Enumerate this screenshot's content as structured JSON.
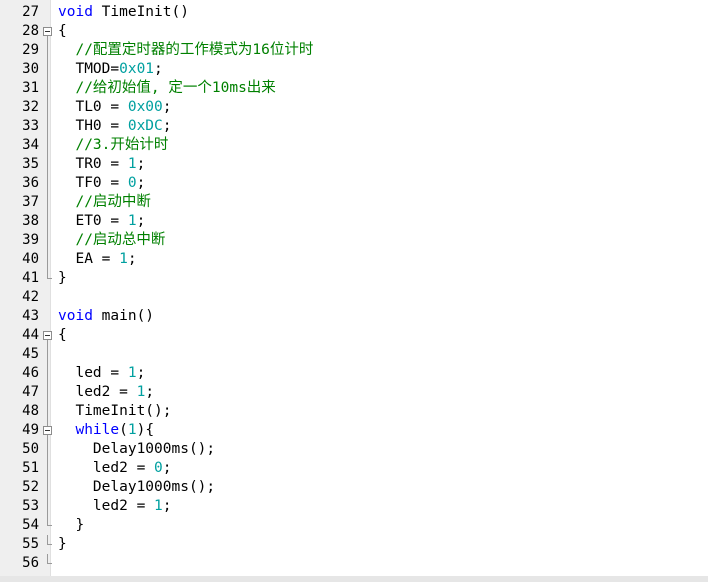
{
  "editor": {
    "lines": [
      {
        "n": "27",
        "fold": "none",
        "segs": [
          {
            "t": "void",
            "c": "kw"
          },
          {
            "t": " TimeInit()",
            "c": ""
          }
        ]
      },
      {
        "n": "28",
        "fold": "open",
        "segs": [
          {
            "t": "{",
            "c": ""
          }
        ]
      },
      {
        "n": "29",
        "fold": "line",
        "segs": [
          {
            "t": "  ",
            "c": ""
          },
          {
            "t": "//配置定时器的工作模式为16位计时",
            "c": "cm"
          }
        ]
      },
      {
        "n": "30",
        "fold": "line",
        "segs": [
          {
            "t": "  TMOD=",
            "c": ""
          },
          {
            "t": "0x01",
            "c": "num"
          },
          {
            "t": ";",
            "c": ""
          }
        ]
      },
      {
        "n": "31",
        "fold": "line",
        "segs": [
          {
            "t": "  ",
            "c": ""
          },
          {
            "t": "//给初始值, 定一个10ms出来",
            "c": "cm"
          }
        ]
      },
      {
        "n": "32",
        "fold": "line",
        "segs": [
          {
            "t": "  TL0 = ",
            "c": ""
          },
          {
            "t": "0x00",
            "c": "num"
          },
          {
            "t": ";",
            "c": ""
          }
        ]
      },
      {
        "n": "33",
        "fold": "line",
        "segs": [
          {
            "t": "  TH0 = ",
            "c": ""
          },
          {
            "t": "0xDC",
            "c": "num"
          },
          {
            "t": ";",
            "c": ""
          }
        ]
      },
      {
        "n": "34",
        "fold": "line",
        "segs": [
          {
            "t": "  ",
            "c": ""
          },
          {
            "t": "//3.开始计时",
            "c": "cm"
          }
        ]
      },
      {
        "n": "35",
        "fold": "line",
        "segs": [
          {
            "t": "  TR0 = ",
            "c": ""
          },
          {
            "t": "1",
            "c": "num"
          },
          {
            "t": ";",
            "c": ""
          }
        ]
      },
      {
        "n": "36",
        "fold": "line",
        "segs": [
          {
            "t": "  TF0 = ",
            "c": ""
          },
          {
            "t": "0",
            "c": "num"
          },
          {
            "t": ";",
            "c": ""
          }
        ]
      },
      {
        "n": "37",
        "fold": "line",
        "segs": [
          {
            "t": "  ",
            "c": ""
          },
          {
            "t": "//启动中断",
            "c": "cm"
          }
        ]
      },
      {
        "n": "38",
        "fold": "line",
        "segs": [
          {
            "t": "  ET0 = ",
            "c": ""
          },
          {
            "t": "1",
            "c": "num"
          },
          {
            "t": ";",
            "c": ""
          }
        ]
      },
      {
        "n": "39",
        "fold": "line",
        "segs": [
          {
            "t": "  ",
            "c": ""
          },
          {
            "t": "//启动总中断",
            "c": "cm"
          }
        ]
      },
      {
        "n": "40",
        "fold": "line",
        "segs": [
          {
            "t": "  EA = ",
            "c": ""
          },
          {
            "t": "1",
            "c": "num"
          },
          {
            "t": ";",
            "c": ""
          }
        ]
      },
      {
        "n": "41",
        "fold": "end",
        "segs": [
          {
            "t": "}",
            "c": ""
          }
        ]
      },
      {
        "n": "42",
        "fold": "none",
        "segs": []
      },
      {
        "n": "43",
        "fold": "none",
        "segs": [
          {
            "t": "void",
            "c": "kw"
          },
          {
            "t": " main()",
            "c": ""
          }
        ]
      },
      {
        "n": "44",
        "fold": "open",
        "segs": [
          {
            "t": "{",
            "c": ""
          }
        ]
      },
      {
        "n": "45",
        "fold": "line",
        "segs": []
      },
      {
        "n": "46",
        "fold": "line",
        "segs": [
          {
            "t": "  led = ",
            "c": ""
          },
          {
            "t": "1",
            "c": "num"
          },
          {
            "t": ";",
            "c": ""
          }
        ]
      },
      {
        "n": "47",
        "fold": "line",
        "segs": [
          {
            "t": "  led2 = ",
            "c": ""
          },
          {
            "t": "1",
            "c": "num"
          },
          {
            "t": ";",
            "c": ""
          }
        ]
      },
      {
        "n": "48",
        "fold": "line",
        "segs": [
          {
            "t": "  TimeInit();",
            "c": ""
          }
        ]
      },
      {
        "n": "49",
        "fold": "open",
        "segs": [
          {
            "t": "  ",
            "c": ""
          },
          {
            "t": "while",
            "c": "kw"
          },
          {
            "t": "(",
            "c": ""
          },
          {
            "t": "1",
            "c": "num"
          },
          {
            "t": "){",
            "c": ""
          }
        ]
      },
      {
        "n": "50",
        "fold": "line",
        "segs": [
          {
            "t": "    Delay1000ms();",
            "c": ""
          }
        ]
      },
      {
        "n": "51",
        "fold": "line",
        "segs": [
          {
            "t": "    led2 = ",
            "c": ""
          },
          {
            "t": "0",
            "c": "num"
          },
          {
            "t": ";",
            "c": ""
          }
        ]
      },
      {
        "n": "52",
        "fold": "line",
        "segs": [
          {
            "t": "    Delay1000ms();",
            "c": ""
          }
        ]
      },
      {
        "n": "53",
        "fold": "line",
        "segs": [
          {
            "t": "    led2 = ",
            "c": ""
          },
          {
            "t": "1",
            "c": "num"
          },
          {
            "t": ";",
            "c": ""
          }
        ]
      },
      {
        "n": "54",
        "fold": "end",
        "segs": [
          {
            "t": "  }",
            "c": ""
          }
        ]
      },
      {
        "n": "55",
        "fold": "end",
        "segs": [
          {
            "t": "}",
            "c": ""
          }
        ]
      },
      {
        "n": "56",
        "fold": "end",
        "segs": []
      }
    ]
  },
  "colors": {
    "keyword": "#0000ff",
    "number": "#00a0a0",
    "comment": "#008000",
    "gutter": "#efefef"
  }
}
